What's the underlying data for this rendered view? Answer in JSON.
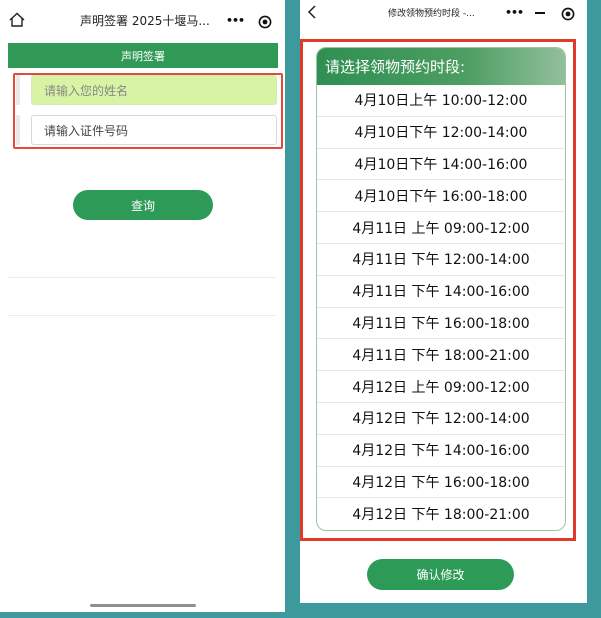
{
  "left": {
    "title": "声明签署 2025十堰马...",
    "banner": "声明签署",
    "name_placeholder": "请输入您的姓名",
    "id_placeholder": "请输入证件号码",
    "query_button": "查询"
  },
  "right": {
    "title": "修改领物预约时段 -...",
    "header": "请选择领物预约时段:",
    "slots": [
      "4月10日上午 10:00-12:00",
      "4月10日下午 12:00-14:00",
      "4月10日下午 14:00-16:00",
      "4月10日下午 16:00-18:00",
      "4月11日 上午 09:00-12:00",
      "4月11日 下午 12:00-14:00",
      "4月11日 下午 14:00-16:00",
      "4月11日 下午 16:00-18:00",
      "4月11日 下午 18:00-21:00",
      "4月12日 上午 09:00-12:00",
      "4月12日 下午 12:00-14:00",
      "4月12日 下午 14:00-16:00",
      "4月12日 下午 16:00-18:00",
      "4月12日 下午 18:00-21:00"
    ],
    "confirm_button": "确认修改"
  },
  "colors": {
    "brand_green": "#2d9b57",
    "highlight_red": "#e03a2a",
    "field_highlight": "#d7f3a3",
    "background_teal": "#3d9a9c"
  },
  "icons": [
    "home-icon",
    "more-dots-icon",
    "target-icon",
    "back-icon",
    "minimize-icon"
  ]
}
